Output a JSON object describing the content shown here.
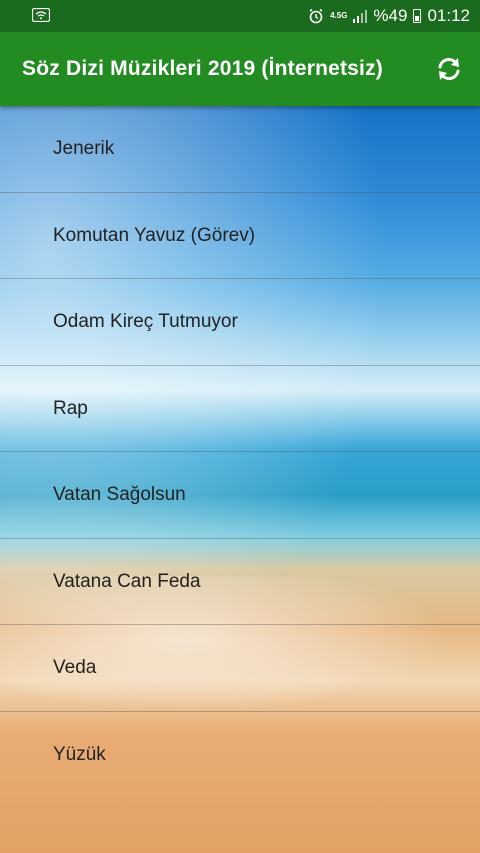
{
  "status_bar": {
    "network": "4.5G",
    "battery": "%49",
    "time": "01:12",
    "icons": [
      "wifi-icon",
      "alarm-icon",
      "signal-icon",
      "battery-icon"
    ]
  },
  "app_bar": {
    "title": "Söz Dizi Müzikleri 2019 (İnternetsiz)",
    "actions": [
      "refresh-icon"
    ],
    "color": "#228b22"
  },
  "songs": [
    {
      "label": "Jenerik"
    },
    {
      "label": "Komutan Yavuz (Görev)"
    },
    {
      "label": "Odam Kireç Tutmuyor"
    },
    {
      "label": "Rap"
    },
    {
      "label": "Vatan Sağolsun"
    },
    {
      "label": "Vatana Can Feda"
    },
    {
      "label": "Veda"
    },
    {
      "label": "Yüzük"
    }
  ]
}
